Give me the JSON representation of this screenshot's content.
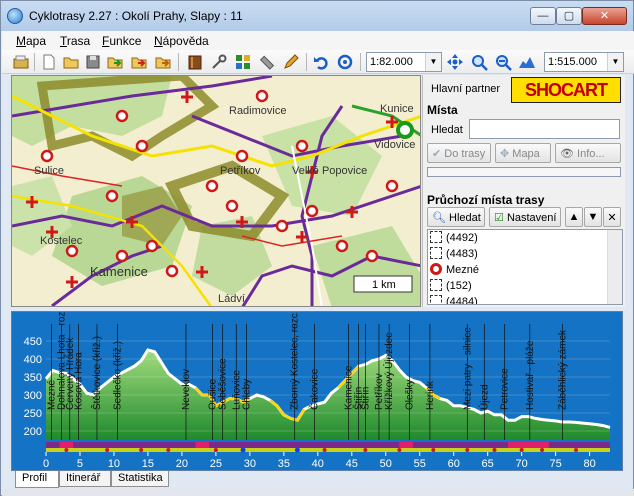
{
  "window": {
    "title": "Cyklotrasy 2.27 : Okolí Prahy, Slapy : 11",
    "min_label": "—",
    "max_label": "▢",
    "close_label": "✕"
  },
  "menu": {
    "items": [
      {
        "label": "Mapa",
        "accel": "M",
        "rest": "apa"
      },
      {
        "label": "Trasa",
        "accel": "T",
        "rest": "rasa"
      },
      {
        "label": "Funkce",
        "accel": "F",
        "rest": "unkce"
      },
      {
        "label": "Nápověda",
        "accel": "N",
        "rest": "ápověda"
      }
    ]
  },
  "toolbar": {
    "scale1": "1:82.000",
    "scale2": "1:515.000",
    "icons": [
      "open-icon",
      "new-icon",
      "folder-icon",
      "save-icon",
      "export-green-icon",
      "export-red-icon",
      "export-folder-icon",
      "book-icon",
      "tools-icon",
      "grid-icon",
      "ruler-icon",
      "pencil-icon",
      "undo-icon",
      "refresh-icon",
      "move-icon",
      "zoom-in-icon",
      "zoom-out-icon",
      "profile-icon"
    ]
  },
  "map": {
    "scale_bar": "1 km",
    "places": [
      {
        "name": "Radimovice"
      },
      {
        "name": "Kunice"
      },
      {
        "name": "Vidovice"
      },
      {
        "name": "Sulice"
      },
      {
        "name": "Petříkov"
      },
      {
        "name": "Velké Popovice"
      },
      {
        "name": "Kostelec"
      },
      {
        "name": "Kamenice"
      },
      {
        "name": "Ládví"
      }
    ]
  },
  "panel": {
    "partner_label": "Hlavní partner",
    "partner_logo": "SHOCART",
    "mista_title": "Místa",
    "hledat_label": "Hledat",
    "hledat_value": "",
    "btn_do_trasy": "Do trasy",
    "btn_mapa": "Mapa",
    "btn_info": "Info...",
    "pruchozi_title": "Průchozí místa trasy",
    "btn_hledat": "Hledat",
    "btn_nastaveni": "Nastavení",
    "list": [
      "(4492)",
      "(4483)",
      "Mezné",
      "(152)",
      "(4484)"
    ]
  },
  "profile": {
    "y_ticks": [
      200,
      250,
      300,
      350,
      400,
      450
    ],
    "x_ticks": [
      0,
      5,
      10,
      15,
      20,
      25,
      30,
      35,
      40,
      45,
      50,
      55,
      60,
      65,
      70,
      75,
      80
    ],
    "labels": [
      {
        "km": 0.8,
        "text": "Mezné"
      },
      {
        "km": 2.3,
        "text": "Dohnalova Lhota - rozc."
      },
      {
        "km": 3.5,
        "text": "Červený Hrádek"
      },
      {
        "km": 4.8,
        "text": "Kosova Hora"
      },
      {
        "km": 7.5,
        "text": "Štětkovice (křiž.)"
      },
      {
        "km": 10.5,
        "text": "Sedlečko (křiž.)"
      },
      {
        "km": 20.6,
        "text": "Nevekiov"
      },
      {
        "km": 24.5,
        "text": "Oušice"
      },
      {
        "km": 26.0,
        "text": "Soběšovice"
      },
      {
        "km": 28.0,
        "text": "Luňovice"
      },
      {
        "km": 29.5,
        "text": "Chleby"
      },
      {
        "km": 36.6,
        "text": "Zborný Kostelec, rozc."
      },
      {
        "km": 39.5,
        "text": "Čakovice"
      },
      {
        "km": 44.5,
        "text": "Kamenice"
      },
      {
        "km": 46.0,
        "text": "Štiřín"
      },
      {
        "km": 47.0,
        "text": "Štiřín"
      },
      {
        "km": 49.0,
        "text": "Petříkov"
      },
      {
        "km": 50.5,
        "text": "Křížkový Újezdec"
      },
      {
        "km": 53.5,
        "text": "Olešky"
      },
      {
        "km": 56.5,
        "text": "Herink"
      },
      {
        "km": 62.0,
        "text": "Mezi patry - silnice"
      },
      {
        "km": 64.5,
        "text": "Újezd"
      },
      {
        "km": 67.5,
        "text": "Petrovice"
      },
      {
        "km": 71.2,
        "text": "Hostivař - pláže"
      },
      {
        "km": 76.0,
        "text": "Záběhlický zámek"
      }
    ],
    "profile_km": [
      0,
      1,
      2,
      3,
      4,
      5,
      6,
      7,
      8,
      9,
      10,
      11,
      12,
      13,
      14,
      15,
      16,
      17,
      18,
      19,
      20,
      21,
      22,
      23,
      24,
      25,
      26,
      27,
      28,
      29,
      30,
      31,
      32,
      33,
      34,
      35,
      36,
      37,
      38,
      39,
      40,
      41,
      42,
      43,
      44,
      45,
      46,
      47,
      48,
      49,
      50,
      51,
      52,
      53,
      54,
      55,
      56,
      57,
      58,
      59,
      60,
      61,
      62,
      63,
      64,
      65,
      66,
      67,
      68,
      69,
      70,
      71,
      72,
      73,
      74,
      75,
      76,
      77,
      78,
      79,
      80,
      81,
      82,
      83
    ],
    "profile_alt": [
      345,
      368,
      362,
      360,
      345,
      330,
      305,
      300,
      320,
      335,
      350,
      360,
      370,
      380,
      395,
      425,
      420,
      390,
      360,
      345,
      330,
      330,
      320,
      300,
      300,
      270,
      280,
      290,
      290,
      280,
      290,
      300,
      295,
      285,
      270,
      245,
      235,
      230,
      260,
      270,
      275,
      280,
      305,
      320,
      340,
      360,
      380,
      385,
      395,
      400,
      410,
      395,
      370,
      350,
      340,
      335,
      320,
      300,
      290,
      285,
      270,
      270,
      265,
      260,
      250,
      255,
      245,
      245,
      230,
      230,
      240,
      240,
      235,
      232,
      230,
      228,
      225,
      225,
      224,
      222,
      220,
      218,
      215,
      210
    ],
    "accent_colors": {
      "bg": "#1473c4",
      "fill_top": "#a2dc7e",
      "fill_bottom": "#1f8a2c",
      "road": "#ffd400"
    }
  },
  "tabs": [
    {
      "label": "Profil",
      "selected": true
    },
    {
      "label": "Itinerář",
      "selected": false
    },
    {
      "label": "Statistika",
      "selected": false
    }
  ]
}
